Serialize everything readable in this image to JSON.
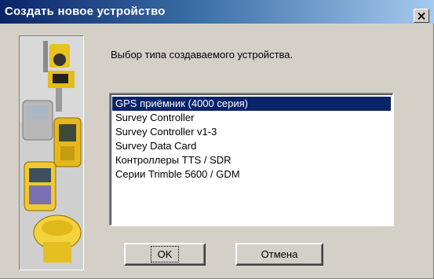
{
  "window": {
    "title": "Создать новое устройство"
  },
  "dialog": {
    "prompt": "Выбор типа создаваемого устройства.",
    "device_types": [
      {
        "label": "GPS приёмник (4000 серия)",
        "selected": true
      },
      {
        "label": "Survey Controller",
        "selected": false
      },
      {
        "label": "Survey Controller v1-3",
        "selected": false
      },
      {
        "label": "Survey Data Card",
        "selected": false
      },
      {
        "label": "Контроллеры TTS / SDR",
        "selected": false
      },
      {
        "label": "Серии Trimble 5600 / GDM",
        "selected": false
      }
    ],
    "ok_label": "OK",
    "cancel_label": "Отмена"
  },
  "icons": {
    "close": "close-icon",
    "picture": "survey-devices-illustration"
  },
  "colors": {
    "title_start": "#0a246a",
    "title_end": "#a6caf0",
    "selection": "#0a246a",
    "face": "#d4d0c8"
  }
}
